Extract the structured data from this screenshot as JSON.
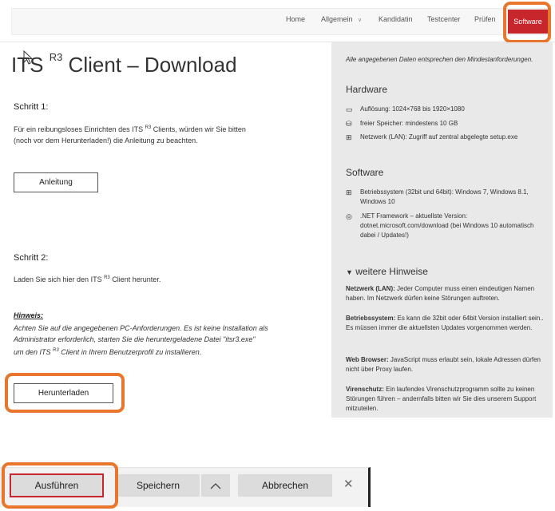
{
  "nav": {
    "items": [
      "Home",
      "Allgemein",
      "Kandidatin",
      "Testcenter",
      "Prüfen",
      "Software"
    ]
  },
  "main": {
    "title_prefix": "ITS",
    "title_sup": "R3",
    "title_suffix": "Client – Download",
    "step1": {
      "heading": "Schritt 1:",
      "text_a": "Für ein reibungsloses Einrichten des ITS",
      "text_sup": "R3",
      "text_b": "Clients, würden wir Sie bitten",
      "text_c": "(noch vor dem Herunterladen!) die Anleitung zu beachten.",
      "button": "Anleitung"
    },
    "step2": {
      "heading": "Schritt 2:",
      "text_a": "Laden Sie sich hier den ITS",
      "text_sup": "R3",
      "text_b": "Client herunter."
    },
    "hint": {
      "label": "Hinweis:",
      "line1": "Achten Sie auf die angegebenen PC-Anforderungen. Es ist keine Installation als",
      "line2": "Administrator erforderlich, starten Sie die heruntergeladene Datei \"itsr3.exe\"",
      "line3_a": "um den ITS",
      "line3_sup": "R3",
      "line3_b": "Client in Ihrem Benutzerprofil zu installieren."
    },
    "download_button": "Herunterladen"
  },
  "panel": {
    "note": "Alle angegebenen Daten entsprechen den Mindestanforderungen.",
    "hardware": {
      "heading": "Hardware",
      "items": [
        "Auflösung: 1024×768 bis 1920×1080",
        "freier Speicher: mindestens 10 GB",
        "Netzwerk (LAN): Zugriff auf zentral abgelegte setup.exe"
      ]
    },
    "software": {
      "heading": "Software",
      "items": [
        "Betriebssystem (32bit und 64bit): Windows 7, Windows 8.1, Windows 10",
        ".NET Framework – aktuellste Version: dotnet.microsoft.com/download (bei Windows 10 automatisch dabei / Updates!)"
      ]
    },
    "more": {
      "heading": "weitere Hinweise",
      "blocks": [
        {
          "label": "Netzwerk (LAN):",
          "text": "Jeder Computer muss einen eindeutigen Namen haben. Im Netzwerk dürfen keine Störungen auftreten."
        },
        {
          "label": "Betriebssystem:",
          "text": "Es kann die 32bit oder 64bit Version installiert sein.. Es müssen immer die aktuellsten Updates vorgenommen werden."
        },
        {
          "label": "Web Browser:",
          "text": "JavaScript muss erlaubt sein, lokale Adressen dürfen nicht über Proxy laufen."
        },
        {
          "label": "Virenschutz:",
          "text": "Ein laufendes Virenschutzprogramm sollte zu keinen Störungen führen – andernfalls bitten wir Sie dies unserem Support mitzuteilen."
        }
      ]
    }
  },
  "download_bar": {
    "run": "Ausführen",
    "save": "Speichern",
    "cancel": "Abbrechen"
  },
  "colors": {
    "accent": "#c7262d",
    "highlight": "#e8762d",
    "panel_bg": "#e9e9e9"
  }
}
